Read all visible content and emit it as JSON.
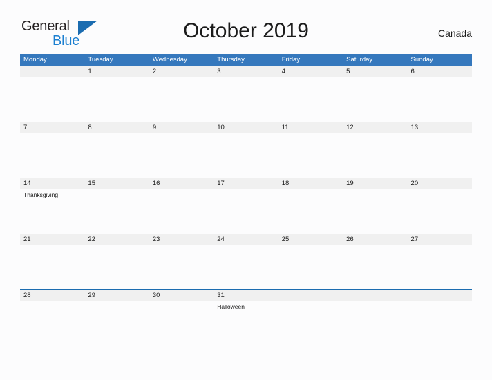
{
  "brand": {
    "name_part1": "General",
    "name_part2": "Blue",
    "mark_icon": "triangle-flag-icon",
    "color_dark": "#231f20",
    "color_blue": "#1b7fd0"
  },
  "header": {
    "title": "October 2019",
    "region": "Canada"
  },
  "theme": {
    "header_blue": "#3578bd",
    "rule_blue": "#1b6cb0",
    "band_gray": "#f0f0f0",
    "page_background": "#fcfcfd",
    "text": "#1b1b1b"
  },
  "calendar": {
    "day_headers": [
      "Monday",
      "Tuesday",
      "Wednesday",
      "Thursday",
      "Friday",
      "Saturday",
      "Sunday"
    ],
    "weeks": [
      [
        {
          "date": "",
          "event": ""
        },
        {
          "date": "1",
          "event": ""
        },
        {
          "date": "2",
          "event": ""
        },
        {
          "date": "3",
          "event": ""
        },
        {
          "date": "4",
          "event": ""
        },
        {
          "date": "5",
          "event": ""
        },
        {
          "date": "6",
          "event": ""
        }
      ],
      [
        {
          "date": "7",
          "event": ""
        },
        {
          "date": "8",
          "event": ""
        },
        {
          "date": "9",
          "event": ""
        },
        {
          "date": "10",
          "event": ""
        },
        {
          "date": "11",
          "event": ""
        },
        {
          "date": "12",
          "event": ""
        },
        {
          "date": "13",
          "event": ""
        }
      ],
      [
        {
          "date": "14",
          "event": "Thanksgiving"
        },
        {
          "date": "15",
          "event": ""
        },
        {
          "date": "16",
          "event": ""
        },
        {
          "date": "17",
          "event": ""
        },
        {
          "date": "18",
          "event": ""
        },
        {
          "date": "19",
          "event": ""
        },
        {
          "date": "20",
          "event": ""
        }
      ],
      [
        {
          "date": "21",
          "event": ""
        },
        {
          "date": "22",
          "event": ""
        },
        {
          "date": "23",
          "event": ""
        },
        {
          "date": "24",
          "event": ""
        },
        {
          "date": "25",
          "event": ""
        },
        {
          "date": "26",
          "event": ""
        },
        {
          "date": "27",
          "event": ""
        }
      ],
      [
        {
          "date": "28",
          "event": ""
        },
        {
          "date": "29",
          "event": ""
        },
        {
          "date": "30",
          "event": ""
        },
        {
          "date": "31",
          "event": "Halloween"
        },
        {
          "date": "",
          "event": ""
        },
        {
          "date": "",
          "event": ""
        },
        {
          "date": "",
          "event": ""
        }
      ]
    ]
  }
}
